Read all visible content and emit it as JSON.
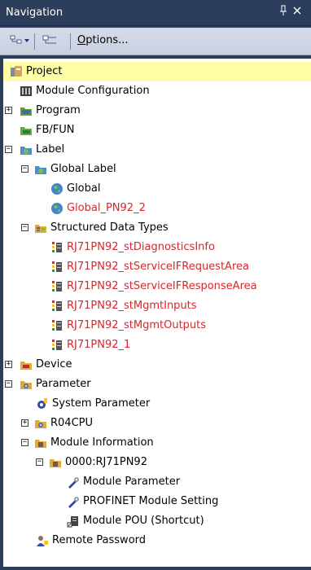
{
  "panel": {
    "title": "Navigation",
    "pin_glyph": "ᵖ",
    "close_glyph": "x"
  },
  "toolbar": {
    "options_label": "Options...",
    "options_mnemonic": "O"
  },
  "tree": {
    "project": "Project",
    "module_configuration": "Module Configuration",
    "program": "Program",
    "fbfun": "FB/FUN",
    "label": "Label",
    "global_label": "Global Label",
    "global": "Global",
    "global_pn92_2": "Global_PN92_2",
    "structured_data_types": "Structured Data Types",
    "sdt_items": [
      "RJ71PN92_stDiagnosticsInfo",
      "RJ71PN92_stServiceIFRequestArea",
      "RJ71PN92_stServiceIFResponseArea",
      "RJ71PN92_stMgmtInputs",
      "RJ71PN92_stMgmtOutputs",
      "RJ71PN92_1"
    ],
    "device": "Device",
    "parameter": "Parameter",
    "system_parameter": "System Parameter",
    "r04cpu": "R04CPU",
    "module_information": "Module Information",
    "module_0000": "0000:RJ71PN92",
    "module_parameter": "Module Parameter",
    "profinet_module_setting": "PROFINET Module Setting",
    "module_pou": "Module POU (Shortcut)",
    "remote_password": "Remote Password"
  },
  "colors": {
    "modified_item": "#d8262a",
    "selected_bg": "#ffffa8",
    "panel_bg": "#2b3e5c"
  }
}
